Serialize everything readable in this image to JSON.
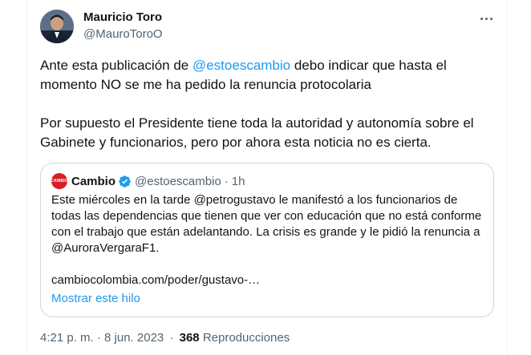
{
  "author": {
    "name": "Mauricio Toro",
    "handle": "@MauroToroO"
  },
  "tweet": {
    "p1_before": "Ante esta publicación de ",
    "p1_mention": "@estoescambio",
    "p1_after": " debo indicar que hasta el momento NO se me ha pedido la renuncia protocolaria",
    "p2": "Por supuesto el Presidente tiene toda la autoridad y autonomía sobre el Gabinete y funcionarios, pero por ahora esta noticia no es cierta."
  },
  "quote": {
    "logo_text": "CAMBIO",
    "name": "Cambio",
    "handle": "@estoescambio",
    "separator": "·",
    "time": "1h",
    "body": "Este miércoles en la tarde @petrogustavo le manifestó a los funcionarios de todas las dependencias que tienen que ver con educación que no está conforme con el trabajo que están adelantando. La crisis es grande y le pidió la renuncia a @AuroraVergaraF1.",
    "link": "cambiocolombia.com/poder/gustavo-…",
    "show_thread": "Mostrar este hilo",
    "colors": {
      "logo": "#d81f26",
      "verified": "#1d9bf0"
    }
  },
  "meta": {
    "timestamp": "4:21 p. m. · 8 jun. 2023",
    "separator": "·",
    "views_count": "368",
    "views_label": "Reproducciones"
  },
  "icons": [
    "more-options-icon",
    "verified-badge-icon"
  ],
  "colors": {
    "link": "#1d9bf0",
    "secondary": "#536471",
    "text": "#0f1419",
    "border": "#cfd9de"
  }
}
